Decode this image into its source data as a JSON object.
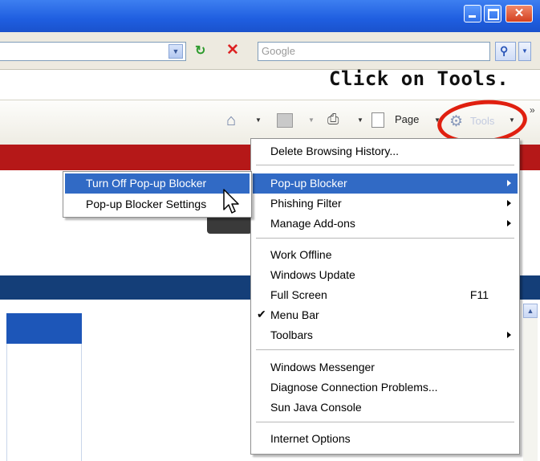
{
  "search": {
    "placeholder": "Google"
  },
  "annotation": {
    "caption": "Click on Tools."
  },
  "commandbar": {
    "page_label": "Page",
    "tools_label": "Tools",
    "more": "»"
  },
  "tools_menu": {
    "items": [
      {
        "label": "Delete Browsing History..."
      },
      {
        "label": "Pop-up Blocker",
        "submenu": true,
        "highlighted": true
      },
      {
        "label": "Phishing Filter",
        "submenu": true
      },
      {
        "label": "Manage Add-ons",
        "submenu": true
      },
      {
        "label": "Work Offline"
      },
      {
        "label": "Windows Update"
      },
      {
        "label": "Full Screen",
        "shortcut": "F11"
      },
      {
        "label": "Menu Bar",
        "checked": true
      },
      {
        "label": "Toolbars",
        "submenu": true
      },
      {
        "label": "Windows Messenger"
      },
      {
        "label": "Diagnose Connection Problems..."
      },
      {
        "label": "Sun Java Console"
      },
      {
        "label": "Internet Options"
      }
    ]
  },
  "popup_submenu": {
    "items": [
      {
        "label": "Turn Off Pop-up Blocker",
        "highlighted": true
      },
      {
        "label": "Pop-up Blocker Settings"
      }
    ]
  },
  "colors": {
    "menu_highlight": "#316ac5",
    "annotation_ring": "#e02010",
    "titlebar": "#1f5ee0"
  }
}
